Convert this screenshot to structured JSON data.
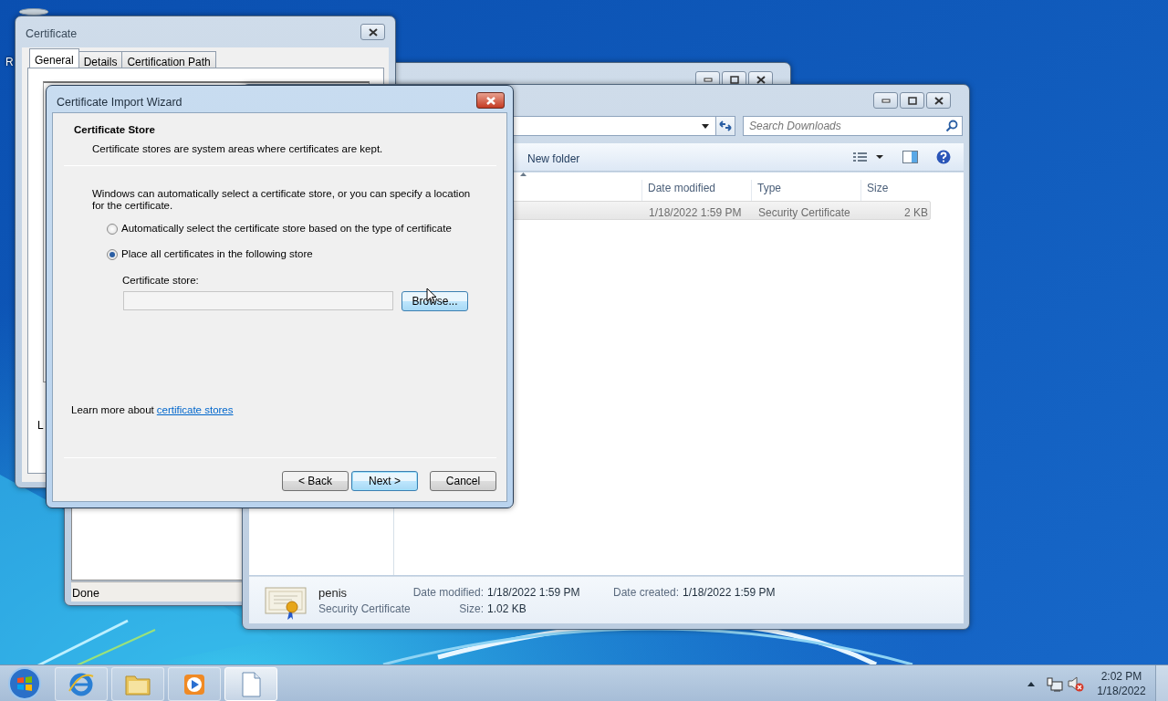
{
  "desktop": {
    "icon_label": "R"
  },
  "certificate_window": {
    "title": "Certificate",
    "tabs": [
      {
        "label": "General",
        "selected": true
      },
      {
        "label": "Details",
        "selected": false
      },
      {
        "label": "Certification Path",
        "selected": false
      }
    ],
    "body_text": "L"
  },
  "browser_window": {
    "status_text": "Done"
  },
  "explorer": {
    "search": {
      "placeholder": "Search Downloads"
    },
    "new_folder": "New folder",
    "columns": [
      "Date modified",
      "Type",
      "Size"
    ],
    "rows": [
      {
        "date_modified": "1/18/2022 1:59 PM",
        "type": "Security Certificate",
        "size": "2 KB",
        "selected": true
      }
    ],
    "details": {
      "name": "penis",
      "type": "Security Certificate",
      "fields": [
        {
          "label": "Date modified:",
          "value": "1/18/2022 1:59 PM"
        },
        {
          "label": "Size:",
          "value": "1.02 KB"
        },
        {
          "label": "Date created:",
          "value": "1/18/2022 1:59 PM"
        }
      ]
    }
  },
  "wizard": {
    "title": "Certificate Import Wizard",
    "heading": "Certificate Store",
    "subheading": "Certificate stores are system areas where certificates are kept.",
    "intro": "Windows can automatically select a certificate store, or you can specify a location for the certificate.",
    "options": [
      {
        "label": "Automatically select the certificate store based on the type of certificate",
        "selected": false
      },
      {
        "label": "Place all certificates in the following store",
        "selected": true
      }
    ],
    "store_label": "Certificate store:",
    "browse": "Browse...",
    "learn_more_text": "Learn more about",
    "learn_more_link": "certificate stores",
    "buttons": [
      {
        "label": "< Back",
        "default": false
      },
      {
        "label": "Next >",
        "default": true
      },
      {
        "label": "Cancel",
        "default": false
      }
    ]
  },
  "taskbar": {
    "apps": [
      {
        "kind": "browser",
        "active": false
      },
      {
        "kind": "folder",
        "active": false
      },
      {
        "kind": "media",
        "active": false
      },
      {
        "kind": "document",
        "active": true
      }
    ],
    "clock": {
      "time": "2:02 PM",
      "date": "1/18/2022"
    }
  }
}
